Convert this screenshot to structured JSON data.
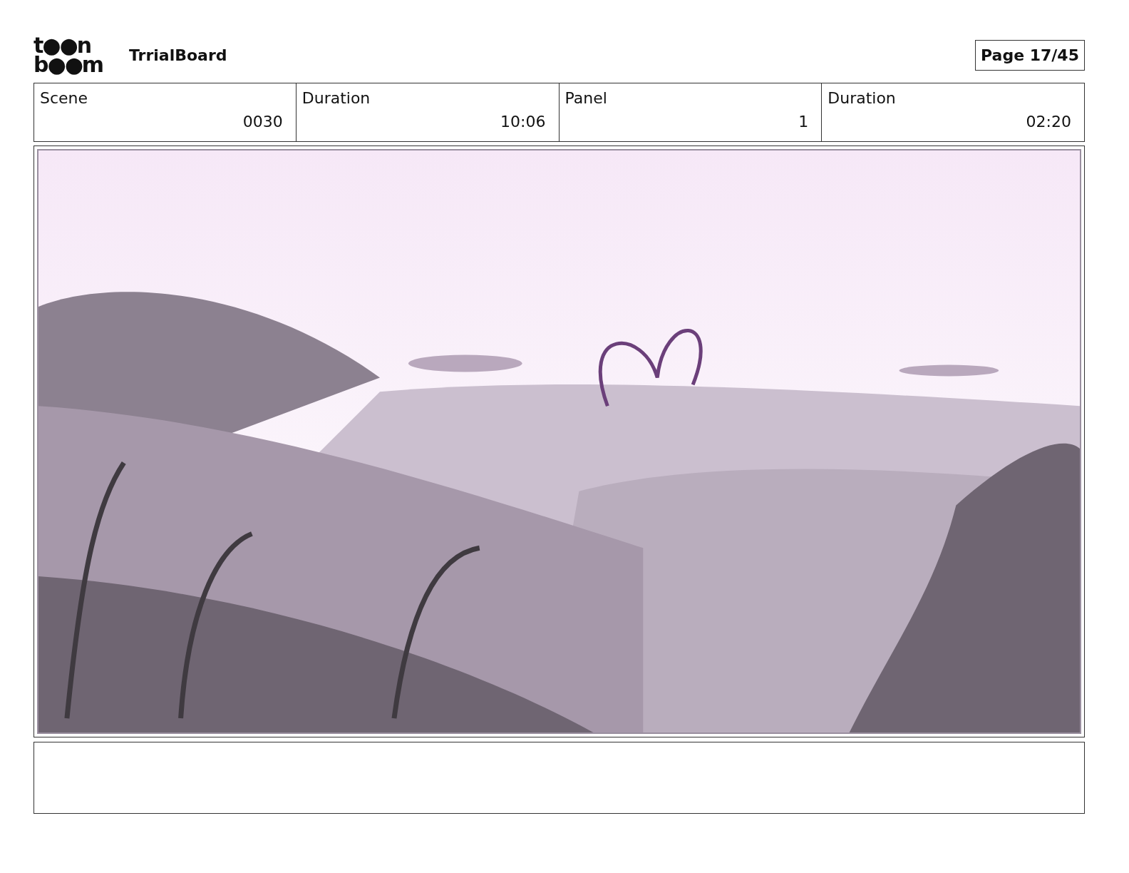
{
  "logo": {
    "line_1": "t●●n",
    "line_2": "b●●m"
  },
  "project": "TrrialBoard",
  "page": "Page 17/45",
  "fields": [
    {
      "label": "Scene",
      "value": "0030"
    },
    {
      "label": "Duration",
      "value": "10:06"
    },
    {
      "label": "Panel",
      "value": "1"
    },
    {
      "label": "Duration",
      "value": "02:20"
    }
  ]
}
